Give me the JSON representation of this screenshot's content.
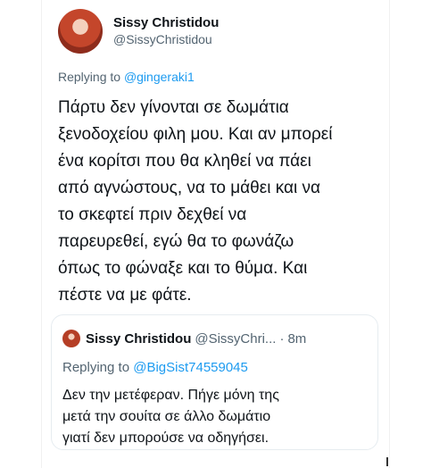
{
  "tweet": {
    "author": {
      "name": "Sissy Christidou",
      "handle": "@SissyChristidou"
    },
    "replying_prefix": "Replying to",
    "replying_to": "@gingeraki1",
    "text_lines": [
      "Πάρτυ δεν γίνονται σε δωμάτια",
      "ξενοδοχείου φιλη μου. Και αν μπορεί",
      "ένα κορίτσι που θα κληθεί να πάει",
      "από αγνώστους, να το μάθει και να",
      "το σκεφτεί πριν δεχθεί να",
      "παρευρεθεί, εγώ θα το φωνάζω",
      "όπως το φώναξε και το θύμα. Και",
      "πέστε να με φάτε."
    ]
  },
  "quoted": {
    "author": {
      "name": "Sissy Christidou",
      "handle": "@SissyChri..."
    },
    "separator": "·",
    "time": "8m",
    "replying_prefix": "Replying to",
    "replying_to": "@BigSist74559045",
    "text_lines": [
      "Δεν την μετέφεραν. Πήγε μόνη της",
      "μετά την σουίτα σε άλλο δωμάτιο",
      "γιατί δεν μπορούσε να οδηγήσει."
    ]
  }
}
